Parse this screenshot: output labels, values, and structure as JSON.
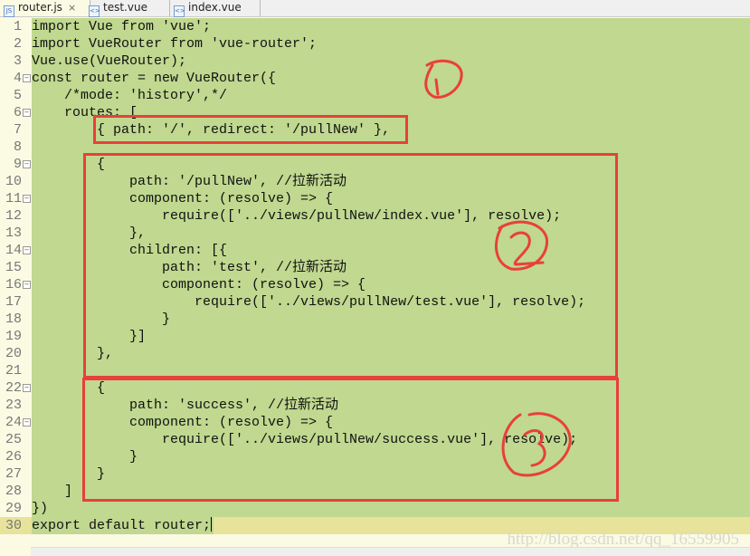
{
  "tabs": [
    {
      "label": "router.js",
      "active": true,
      "close": "×",
      "icon": "js-file-icon"
    },
    {
      "label": "test.vue",
      "active": false,
      "icon": "vue-file-icon"
    },
    {
      "label": "index.vue",
      "active": false,
      "icon": "vue-file-icon"
    }
  ],
  "colors": {
    "selection": "#c0d88f",
    "annotation": "#e8403a",
    "current_line": "#e7e39a"
  },
  "lines": [
    {
      "n": "1",
      "text": "import Vue from 'vue';"
    },
    {
      "n": "2",
      "text": "import VueRouter from 'vue-router';"
    },
    {
      "n": "3",
      "text": "Vue.use(VueRouter);"
    },
    {
      "n": "4",
      "text": "const router = new VueRouter({",
      "fold": true
    },
    {
      "n": "5",
      "text": "    /*mode: 'history',*/"
    },
    {
      "n": "6",
      "text": "    routes: [",
      "fold": true
    },
    {
      "n": "7",
      "text": "        { path: '/', redirect: '/pullNew' },"
    },
    {
      "n": "8",
      "text": ""
    },
    {
      "n": "9",
      "text": "        {",
      "fold": true
    },
    {
      "n": "10",
      "text": "            path: '/pullNew', //拉新活动"
    },
    {
      "n": "11",
      "text": "            component: (resolve) => {",
      "fold": true
    },
    {
      "n": "12",
      "text": "                require(['../views/pullNew/index.vue'], resolve);"
    },
    {
      "n": "13",
      "text": "            },"
    },
    {
      "n": "14",
      "text": "            children: [{",
      "fold": true
    },
    {
      "n": "15",
      "text": "                path: 'test', //拉新活动"
    },
    {
      "n": "16",
      "text": "                component: (resolve) => {",
      "fold": true
    },
    {
      "n": "17",
      "text": "                    require(['../views/pullNew/test.vue'], resolve);"
    },
    {
      "n": "18",
      "text": "                }"
    },
    {
      "n": "19",
      "text": "            }]"
    },
    {
      "n": "20",
      "text": "        },"
    },
    {
      "n": "21",
      "text": ""
    },
    {
      "n": "22",
      "text": "        {",
      "fold": true
    },
    {
      "n": "23",
      "text": "            path: 'success', //拉新活动"
    },
    {
      "n": "24",
      "text": "            component: (resolve) => {",
      "fold": true
    },
    {
      "n": "25",
      "text": "                require(['../views/pullNew/success.vue'], resolve);"
    },
    {
      "n": "26",
      "text": "            }"
    },
    {
      "n": "27",
      "text": "        }"
    },
    {
      "n": "28",
      "text": "    ]"
    },
    {
      "n": "29",
      "text": "})"
    },
    {
      "n": "30",
      "text": "export default router;",
      "current": true
    }
  ],
  "annotations": [
    "1",
    "2",
    "3"
  ],
  "watermark": "http://blog.csdn.net/qq_16559905"
}
